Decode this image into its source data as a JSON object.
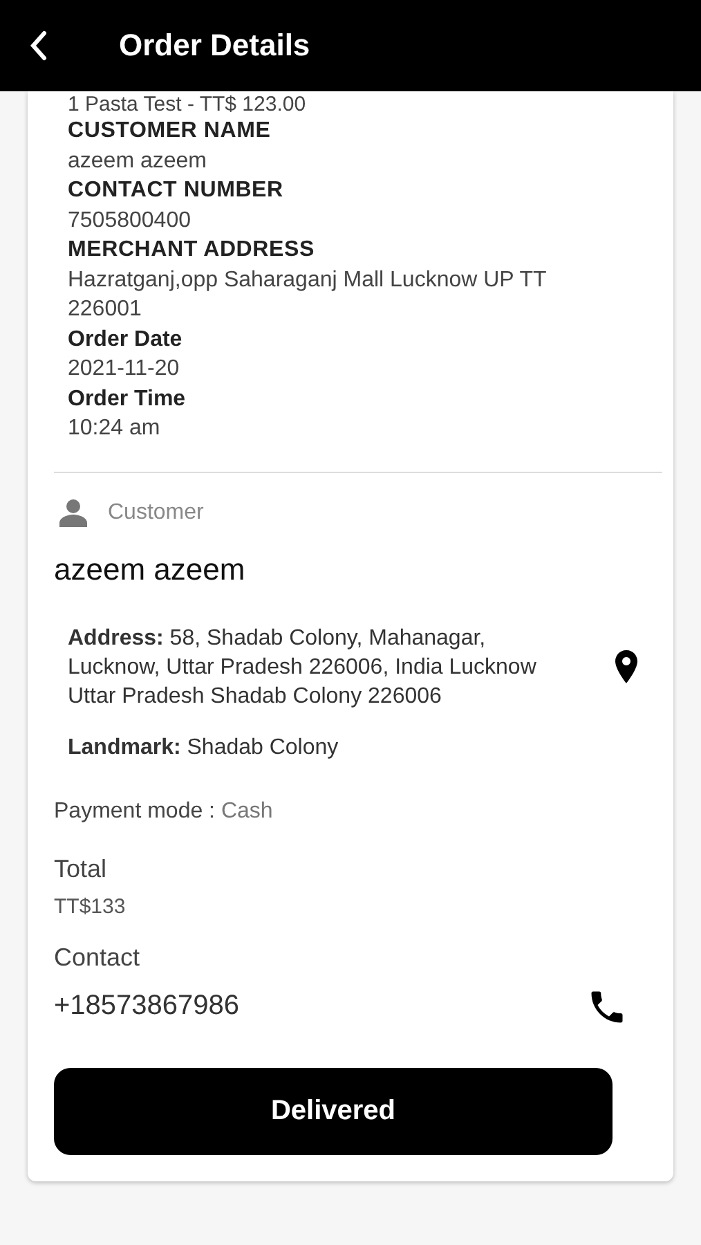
{
  "header": {
    "title": "Order Details"
  },
  "order_info": [
    {
      "kind": "item",
      "text": "1 Pasta Test - TT$ 123.00"
    },
    {
      "kind": "label",
      "text": "CUSTOMER NAME"
    },
    {
      "kind": "value",
      "text": "azeem azeem"
    },
    {
      "kind": "label",
      "text": "CONTACT NUMBER"
    },
    {
      "kind": "value",
      "text": "7505800400"
    },
    {
      "kind": "label",
      "text": "MERCHANT ADDRESS"
    },
    {
      "kind": "value",
      "text": "Hazratganj,opp Saharaganj Mall Lucknow UP TT 226001"
    },
    {
      "kind": "heading",
      "text": "Order Date"
    },
    {
      "kind": "value",
      "text": "2021-11-20"
    },
    {
      "kind": "heading",
      "text": "Order Time"
    },
    {
      "kind": "value",
      "text": "10:24 am"
    }
  ],
  "customer": {
    "section_label": "Customer",
    "name": "azeem azeem",
    "address": "**Address:** 58, Shadab Colony, Mahanagar, Lucknow, Uttar Pradesh 226006, India Lucknow Uttar Pradesh Shadab Colony 226006",
    "landmark": "**Landmark:** Shadab Colony"
  },
  "payment": {
    "label": "Payment mode :",
    "value": "Cash"
  },
  "total": {
    "label": "Total",
    "value": "TT$133"
  },
  "contact": {
    "label": "Contact",
    "value": "+18573867986"
  },
  "action_button": "Delivered"
}
